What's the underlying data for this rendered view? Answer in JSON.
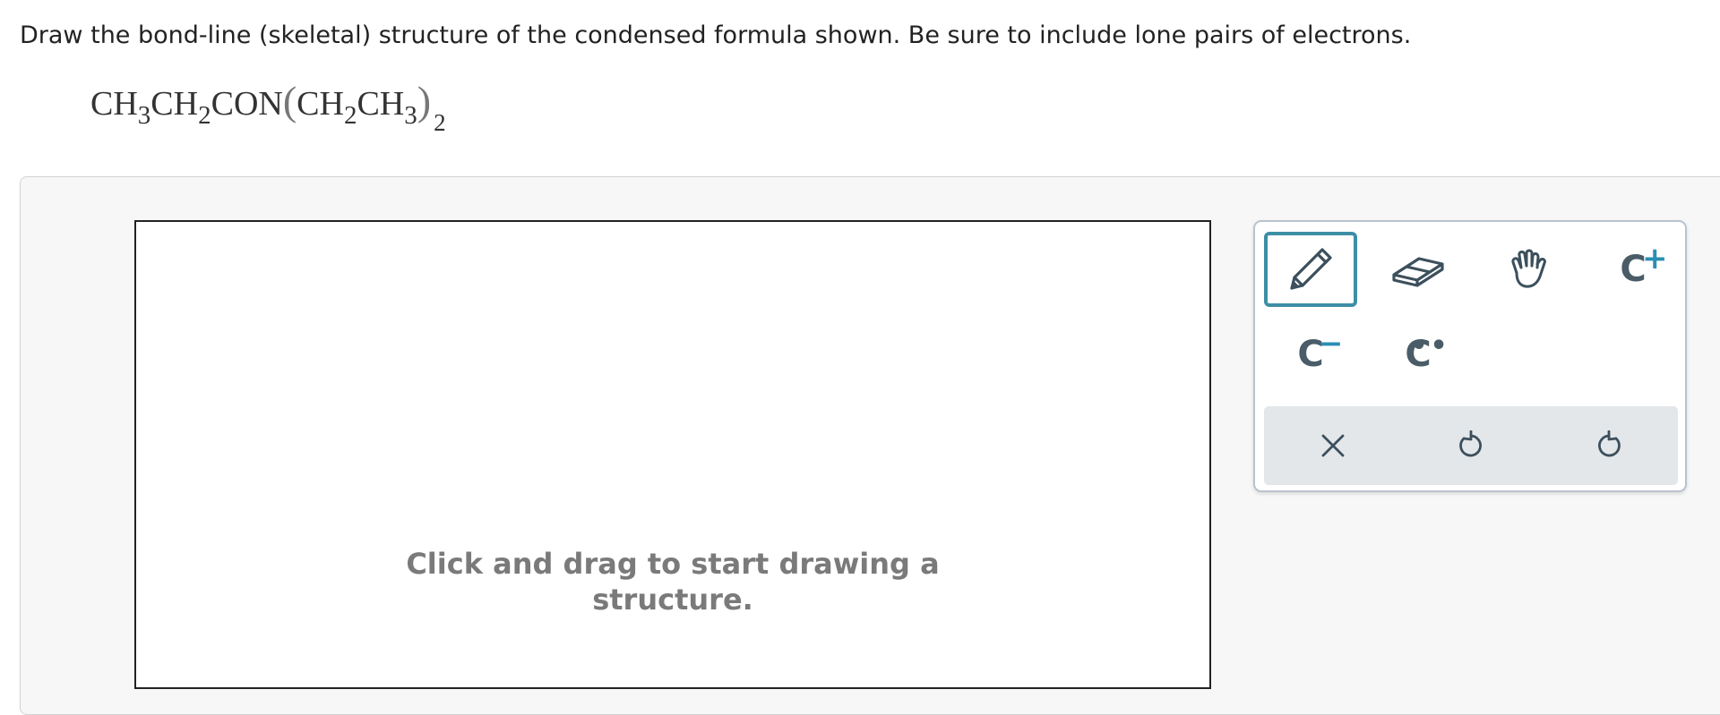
{
  "question": {
    "prompt": "Draw the bond-line (skeletal) structure of the condensed formula shown. Be sure to include lone pairs of electrons."
  },
  "formula": {
    "part1": "CH",
    "sub1": "3",
    "part2": "CH",
    "sub2": "2",
    "part3": "CON",
    "paren_open": "(",
    "part4": "CH",
    "sub3": "2",
    "part5": "CH",
    "sub4": "3",
    "paren_close": ")",
    "sub5": "2"
  },
  "canvas": {
    "hint_line1": "Click and drag to start drawing a",
    "hint_line2": "structure."
  },
  "toolbox": {
    "tools": [
      {
        "name": "pencil",
        "icon": "pencil-icon",
        "selected": true
      },
      {
        "name": "eraser",
        "icon": "eraser-icon",
        "selected": false
      },
      {
        "name": "hand",
        "icon": "hand-icon",
        "selected": false
      },
      {
        "name": "positive-charge",
        "letter": "C",
        "mark": "+"
      },
      {
        "name": "negative-charge",
        "letter": "C",
        "mark": "−"
      },
      {
        "name": "lone-pair",
        "letter": "C",
        "mark": "••"
      }
    ],
    "actions": [
      {
        "name": "clear",
        "icon": "close-icon"
      },
      {
        "name": "undo",
        "icon": "undo-icon"
      },
      {
        "name": "redo",
        "icon": "redo-icon"
      }
    ],
    "accent_color": "#3d8fa6",
    "charge_color": "#2b8fb3",
    "icon_color": "#4a5c68"
  }
}
